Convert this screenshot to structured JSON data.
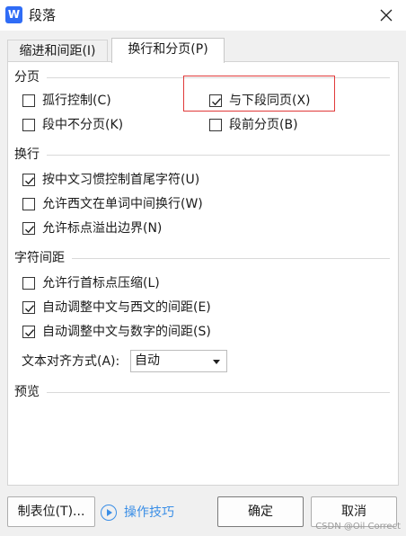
{
  "window": {
    "title": "段落",
    "app_icon_letter": "W",
    "accent": "#2f6cf6"
  },
  "tabs": [
    {
      "label": "缩进和间距(I)",
      "active": false
    },
    {
      "label": "换行和分页(P)",
      "active": true
    }
  ],
  "sections": {
    "pagination": {
      "title": "分页",
      "options": [
        {
          "label": "孤行控制(C)",
          "checked": false
        },
        {
          "label": "与下段同页(X)",
          "checked": true
        },
        {
          "label": "段中不分页(K)",
          "checked": false
        },
        {
          "label": "段前分页(B)",
          "checked": false
        }
      ]
    },
    "line_break": {
      "title": "换行",
      "options": [
        {
          "label": "按中文习惯控制首尾字符(U)",
          "checked": true
        },
        {
          "label": "允许西文在单词中间换行(W)",
          "checked": false
        },
        {
          "label": "允许标点溢出边界(N)",
          "checked": true
        }
      ]
    },
    "char_spacing": {
      "title": "字符间距",
      "options": [
        {
          "label": "允许行首标点压缩(L)",
          "checked": false
        },
        {
          "label": "自动调整中文与西文的间距(E)",
          "checked": true
        },
        {
          "label": "自动调整中文与数字的间距(S)",
          "checked": true
        }
      ],
      "text_align": {
        "label": "文本对齐方式(A):",
        "value": "自动"
      }
    },
    "preview": {
      "title": "预览"
    }
  },
  "footer": {
    "tabs_button": "制表位(T)...",
    "tips_link": "操作技巧",
    "ok_button": "确定",
    "cancel_button": "取消"
  },
  "highlight_color": "#e03a3a",
  "link_color": "#3a8ee6",
  "watermark": "CSDN @Oil Correct"
}
